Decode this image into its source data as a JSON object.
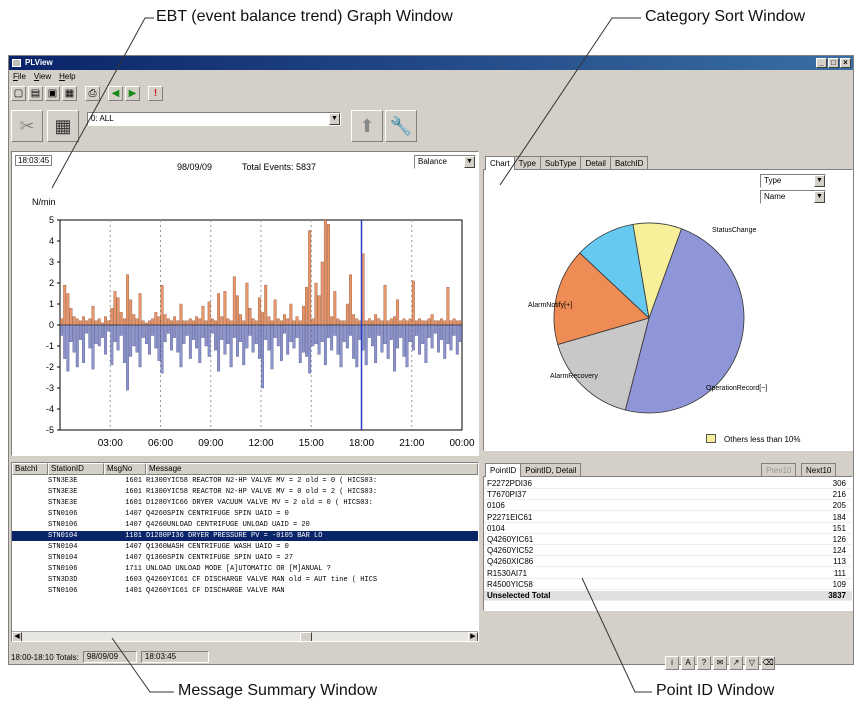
{
  "callouts": {
    "ebt": "EBT (event balance trend) Graph Window",
    "category": "Category Sort Window",
    "message": "Message Summary Window",
    "point": "Point ID Window"
  },
  "window": {
    "title": "PLView",
    "menu": [
      "File",
      "View",
      "Help"
    ],
    "filter_value": "0: ALL"
  },
  "ebt": {
    "time": "18:03:45",
    "date": "98/09/09",
    "total_label": "Total Events: 5837",
    "mode": "Balance",
    "unit": "N/min"
  },
  "category": {
    "tabs": [
      "Chart",
      "Type",
      "SubType",
      "Detail",
      "BatchID"
    ],
    "active_tab": "Chart",
    "select_type": "Type",
    "select_name": "Name",
    "legend_text": "Others less than 10%"
  },
  "chart_data": [
    {
      "type": "bar",
      "ylabel": "N/min",
      "ylim": [
        -5,
        5
      ],
      "yticks": [
        5,
        4,
        3,
        2,
        1,
        0,
        -1,
        -2,
        -3,
        -4,
        -5
      ],
      "x_tick_labels": [
        "03:00",
        "06:00",
        "09:00",
        "12:00",
        "15:00",
        "18:00",
        "21:00",
        "00:00"
      ],
      "colors": {
        "positive": "#e8956a",
        "negative": "#8c94cc",
        "cursor": "#2a3fbf"
      },
      "cursor_x": 18.0,
      "series": [
        {
          "name": "positive",
          "values": [
            0.3,
            1.9,
            1.5,
            0.8,
            0.4,
            0.3,
            0.2,
            0.4,
            0.2,
            0.3,
            0.9,
            0.2,
            0.3,
            0.1,
            0.4,
            0.2,
            0.8,
            1.6,
            1.3,
            0.6,
            0.3,
            2.4,
            1.2,
            0.5,
            0.3,
            1.5,
            0.2,
            0.1,
            0.2,
            0.3,
            0.6,
            0.4,
            1.9,
            0.5,
            0.3,
            0.2,
            0.4,
            0.2,
            1.0,
            0.2,
            0.2,
            0.3,
            0.2,
            0.4,
            0.3,
            0.9,
            0.2,
            1.1,
            0.3,
            0.2,
            1.5,
            0.4,
            1.6,
            0.3,
            0.2,
            2.3,
            1.4,
            0.5,
            0.2,
            2.0,
            0.8,
            0.3,
            0.2,
            1.3,
            0.6,
            1.9,
            0.4,
            0.2,
            1.2,
            0.3,
            0.2,
            0.5,
            0.3,
            1.0,
            0.2,
            0.4,
            0.2,
            0.9,
            1.8,
            4.5,
            0.3,
            2.0,
            1.4,
            3.0,
            5.0,
            4.8,
            0.4,
            1.6,
            0.3,
            0.2,
            0.2,
            1.0,
            2.4,
            0.5,
            0.3,
            0.2,
            3.4,
            0.2,
            0.3,
            0.2,
            0.5,
            0.3,
            0.2,
            1.9,
            0.2,
            0.3,
            0.4,
            1.2,
            0.2,
            0.3,
            0.2,
            0.3,
            2.1,
            0.2,
            0.3,
            0.2,
            0.2,
            0.3,
            0.5,
            0.2,
            0.2,
            0.3,
            0.2,
            1.8,
            0.2,
            0.3,
            0.2,
            0.2
          ]
        },
        {
          "name": "negative",
          "values": [
            -0.5,
            -1.6,
            -2.2,
            -0.8,
            -1.3,
            -2.0,
            -0.7,
            -1.8,
            -0.4,
            -1.1,
            -2.1,
            -0.9,
            -1.0,
            -0.6,
            -1.4,
            -0.3,
            -1.9,
            -0.8,
            -1.2,
            -0.5,
            -1.8,
            -3.1,
            -1.5,
            -1.0,
            -1.3,
            -2.0,
            -0.6,
            -0.9,
            -1.4,
            -0.5,
            -1.1,
            -1.7,
            -2.3,
            -0.8,
            -0.4,
            -1.2,
            -0.6,
            -1.3,
            -2.0,
            -0.9,
            -0.5,
            -1.6,
            -0.7,
            -1.1,
            -1.8,
            -0.6,
            -1.0,
            -1.5,
            -0.4,
            -1.2,
            -2.2,
            -0.7,
            -1.4,
            -0.9,
            -2.0,
            -0.6,
            -1.5,
            -0.8,
            -1.9,
            -1.1,
            -0.5,
            -1.3,
            -0.9,
            -1.6,
            -3.0,
            -0.7,
            -1.2,
            -2.1,
            -0.6,
            -1.0,
            -1.7,
            -0.4,
            -1.4,
            -0.8,
            -1.1,
            -0.6,
            -1.8,
            -1.3,
            -1.5,
            -2.3,
            -1.0,
            -0.9,
            -1.4,
            -0.8,
            -1.9,
            -0.6,
            -1.2,
            -0.5,
            -1.4,
            -2.0,
            -0.8,
            -1.1,
            -0.5,
            -1.6,
            -2.0,
            -0.7,
            -1.2,
            -1.9,
            -0.6,
            -1.0,
            -1.8,
            -0.5,
            -1.3,
            -0.9,
            -1.6,
            -0.7,
            -2.2,
            -1.1,
            -0.6,
            -1.5,
            -2.0,
            -0.8,
            -1.2,
            -0.5,
            -1.4,
            -0.9,
            -1.8,
            -0.6,
            -1.1,
            -0.4,
            -1.3,
            -0.7,
            -1.6,
            -0.9,
            -1.2,
            -0.5,
            -1.4,
            -0.8
          ]
        }
      ]
    },
    {
      "type": "pie",
      "labels": [
        "StatusChange",
        "OperationRecord[~]",
        "AlarmRecovery",
        "AlarmNotify[+]",
        "Others"
      ],
      "values": [
        47,
        16,
        16,
        10,
        8
      ],
      "colors": [
        "#8f96d8",
        "#c8c8c8",
        "#ef8b55",
        "#66c9ef",
        "#f7ef9a"
      ],
      "show_label": [
        true,
        true,
        true,
        true,
        false
      ]
    }
  ],
  "messages": {
    "headers": [
      "BatchI",
      "StationID",
      "MsgNo",
      "Message"
    ],
    "rows": [
      {
        "station": "STN3E3E",
        "msgno": "1601",
        "message": "R1300YIC58 REACTOR N2-HP VALVE MV = 2 old = 0 ( HICS03:"
      },
      {
        "station": "STN3E3E",
        "msgno": "1601",
        "message": "R1300YIC58 REACTOR N2-HP VALVE MV = 0 old = 2 ( HICS03:"
      },
      {
        "station": "STN3E3E",
        "msgno": "1601",
        "message": "D1280YIC66 DRYER VACUUM VALVE MV = 2 old = 0 ( HICS03:"
      },
      {
        "station": "STN0106",
        "msgno": "1407",
        "message": "Q4260SPIN CENTRIFUGE SPIN UAID = 0"
      },
      {
        "station": "STN0106",
        "msgno": "1407",
        "message": "Q4260UNLOAD CENTRIFUGE UNLOAD UAID = 20"
      },
      {
        "station": "STN0104",
        "msgno": "1101",
        "message": "D1280PI36 DRYER PRESSURE PV = -0105 BAR LO"
      },
      {
        "station": "STN0104",
        "msgno": "1407",
        "message": "Q1360WASH CENTRIFUGE WASH UAID = 0"
      },
      {
        "station": "STN0104",
        "msgno": "1407",
        "message": "Q1360SPIN CENTRIFUGE SPIN UAID = 27"
      },
      {
        "station": "STN0106",
        "msgno": "1711",
        "message": "UNLOAD UNLOAD MODE [A]UTOMATIC OR [M]ANUAL ?"
      },
      {
        "station": "STN3D3D",
        "msgno": "1603",
        "message": "Q4260YIC61 CF DISCHARGE VALVE MAN old = AUT tine ( HICS"
      },
      {
        "station": "STN0106",
        "msgno": "1401",
        "message": "Q4260YIC61 CF DISCHARGE VALVE MAN"
      }
    ],
    "selected_index": 5
  },
  "points": {
    "tabs": [
      "PointID",
      "PointID, Detail"
    ],
    "prev_label": "Prev10",
    "next_label": "Next10",
    "rows": [
      {
        "id": "F2272PDI36",
        "count": "306"
      },
      {
        "id": "T7670PI37",
        "count": "216"
      },
      {
        "id": "0106",
        "count": "205"
      },
      {
        "id": "P2271EIC61",
        "count": "184"
      },
      {
        "id": "0104",
        "count": "151"
      },
      {
        "id": "Q4260YIC61",
        "count": "126"
      },
      {
        "id": "Q4260YIC52",
        "count": "124"
      },
      {
        "id": "Q4260XIC86",
        "count": "113"
      },
      {
        "id": "R1530AI71",
        "count": "111"
      },
      {
        "id": "R4500YIC58",
        "count": "109"
      }
    ],
    "total_label": "Unselected Total",
    "total_count": "3837"
  },
  "status": {
    "range": "18:00-18:10 Totals:",
    "date": "98/09/09",
    "time": "18:03:45"
  }
}
